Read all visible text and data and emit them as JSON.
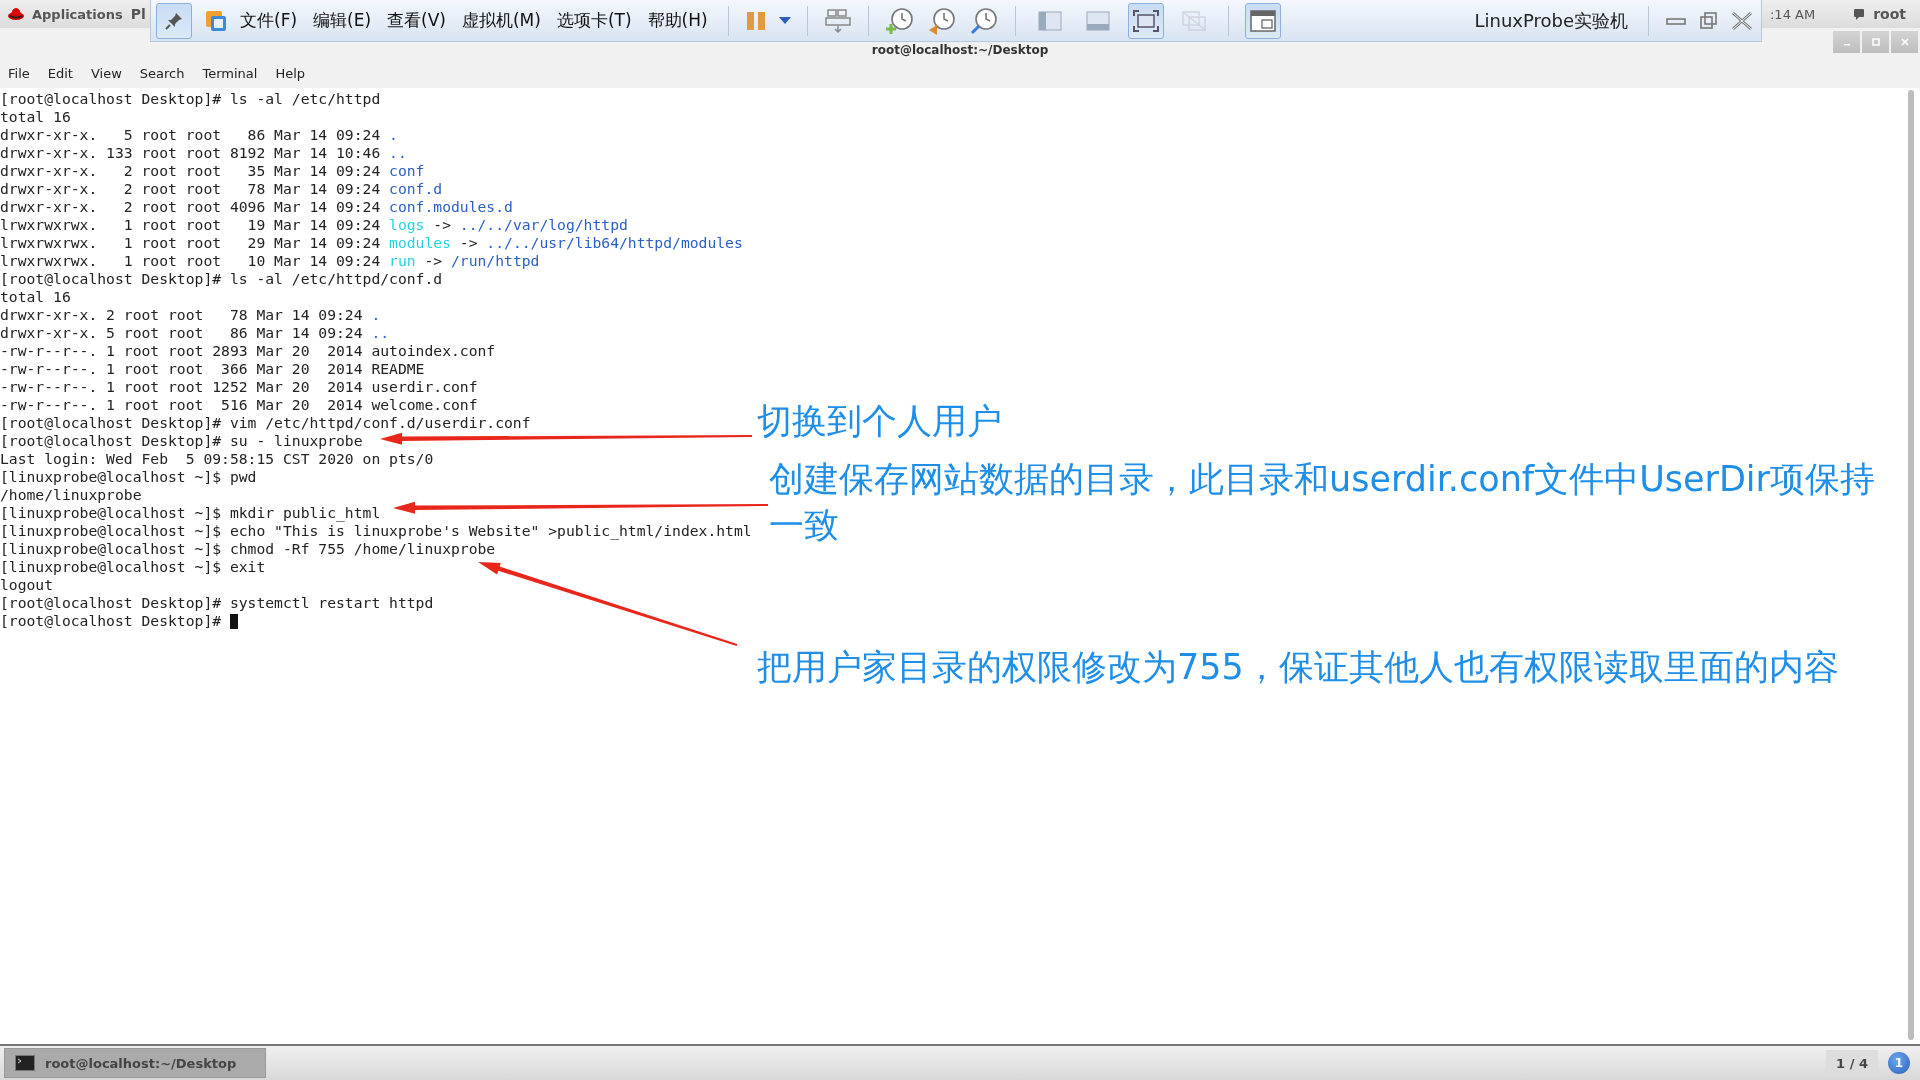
{
  "top_bar": {
    "applications": "Applications",
    "places": "Pl",
    "clock": ":14 AM",
    "user": "root"
  },
  "vm_toolbar": {
    "pinned": true,
    "menus": [
      "文件(F)",
      "编辑(E)",
      "查看(V)",
      "虚拟机(M)",
      "选项卡(T)",
      "帮助(H)"
    ],
    "view_modes": [
      {
        "selected": false,
        "disabled": false
      },
      {
        "selected": false,
        "disabled": false
      },
      {
        "selected": true,
        "disabled": false
      },
      {
        "selected": false,
        "disabled": true
      }
    ],
    "console_view": {
      "selected": true
    },
    "title": "LinuxProbe实验机"
  },
  "terminal": {
    "title": "root@localhost:~/Desktop",
    "menus": [
      "File",
      "Edit",
      "View",
      "Search",
      "Terminal",
      "Help"
    ],
    "lines": [
      {
        "segments": [
          {
            "kind": "plain",
            "text": "[root@localhost Desktop]# ls -al /etc/httpd"
          }
        ]
      },
      {
        "segments": [
          {
            "kind": "plain",
            "text": "total 16"
          }
        ]
      },
      {
        "segments": [
          {
            "kind": "plain",
            "text": "drwxr-xr-x.   5 root root   86 Mar 14 09:24 "
          },
          {
            "kind": "dir",
            "text": "."
          }
        ]
      },
      {
        "segments": [
          {
            "kind": "plain",
            "text": "drwxr-xr-x. 133 root root 8192 Mar 14 10:46 "
          },
          {
            "kind": "dir",
            "text": ".."
          }
        ]
      },
      {
        "segments": [
          {
            "kind": "plain",
            "text": "drwxr-xr-x.   2 root root   35 Mar 14 09:24 "
          },
          {
            "kind": "dir",
            "text": "conf"
          }
        ]
      },
      {
        "segments": [
          {
            "kind": "plain",
            "text": "drwxr-xr-x.   2 root root   78 Mar 14 09:24 "
          },
          {
            "kind": "dir",
            "text": "conf.d"
          }
        ]
      },
      {
        "segments": [
          {
            "kind": "plain",
            "text": "drwxr-xr-x.   2 root root 4096 Mar 14 09:24 "
          },
          {
            "kind": "dir",
            "text": "conf.modules.d"
          }
        ]
      },
      {
        "segments": [
          {
            "kind": "plain",
            "text": "lrwxrwxrwx.   1 root root   19 Mar 14 09:24 "
          },
          {
            "kind": "link",
            "text": "logs"
          },
          {
            "kind": "plain",
            "text": " -> "
          },
          {
            "kind": "dir",
            "text": "../../var/log/httpd"
          }
        ]
      },
      {
        "segments": [
          {
            "kind": "plain",
            "text": "lrwxrwxrwx.   1 root root   29 Mar 14 09:24 "
          },
          {
            "kind": "link",
            "text": "modules"
          },
          {
            "kind": "plain",
            "text": " -> "
          },
          {
            "kind": "dir",
            "text": "../../usr/lib64/httpd/modules"
          }
        ]
      },
      {
        "segments": [
          {
            "kind": "plain",
            "text": "lrwxrwxrwx.   1 root root   10 Mar 14 09:24 "
          },
          {
            "kind": "link",
            "text": "run"
          },
          {
            "kind": "plain",
            "text": " -> "
          },
          {
            "kind": "dir",
            "text": "/run/httpd"
          }
        ]
      },
      {
        "segments": [
          {
            "kind": "plain",
            "text": "[root@localhost Desktop]# ls -al /etc/httpd/conf.d"
          }
        ]
      },
      {
        "segments": [
          {
            "kind": "plain",
            "text": "total 16"
          }
        ]
      },
      {
        "segments": [
          {
            "kind": "plain",
            "text": "drwxr-xr-x. 2 root root   78 Mar 14 09:24 "
          },
          {
            "kind": "dir",
            "text": "."
          }
        ]
      },
      {
        "segments": [
          {
            "kind": "plain",
            "text": "drwxr-xr-x. 5 root root   86 Mar 14 09:24 "
          },
          {
            "kind": "dir",
            "text": ".."
          }
        ]
      },
      {
        "segments": [
          {
            "kind": "plain",
            "text": "-rw-r--r--. 1 root root 2893 Mar 20  2014 autoindex.conf"
          }
        ]
      },
      {
        "segments": [
          {
            "kind": "plain",
            "text": "-rw-r--r--. 1 root root  366 Mar 20  2014 README"
          }
        ]
      },
      {
        "segments": [
          {
            "kind": "plain",
            "text": "-rw-r--r--. 1 root root 1252 Mar 20  2014 userdir.conf"
          }
        ]
      },
      {
        "segments": [
          {
            "kind": "plain",
            "text": "-rw-r--r--. 1 root root  516 Mar 20  2014 welcome.conf"
          }
        ]
      },
      {
        "segments": [
          {
            "kind": "plain",
            "text": "[root@localhost Desktop]# vim /etc/httpd/conf.d/userdir.conf"
          }
        ]
      },
      {
        "segments": [
          {
            "kind": "plain",
            "text": "[root@localhost Desktop]# su - linuxprobe"
          }
        ]
      },
      {
        "segments": [
          {
            "kind": "plain",
            "text": "Last login: Wed Feb  5 09:58:15 CST 2020 on pts/0"
          }
        ]
      },
      {
        "segments": [
          {
            "kind": "plain",
            "text": "[linuxprobe@localhost ~]$ pwd"
          }
        ]
      },
      {
        "segments": [
          {
            "kind": "plain",
            "text": "/home/linuxprobe"
          }
        ]
      },
      {
        "segments": [
          {
            "kind": "plain",
            "text": "[linuxprobe@localhost ~]$ mkdir public_html"
          }
        ]
      },
      {
        "segments": [
          {
            "kind": "plain",
            "text": "[linuxprobe@localhost ~]$ echo \"This is linuxprobe's Website\" >public_html/index.html"
          }
        ]
      },
      {
        "segments": [
          {
            "kind": "plain",
            "text": "[linuxprobe@localhost ~]$ chmod -Rf 755 /home/linuxprobe"
          }
        ]
      },
      {
        "segments": [
          {
            "kind": "plain",
            "text": "[linuxprobe@localhost ~]$ exit"
          }
        ]
      },
      {
        "segments": [
          {
            "kind": "plain",
            "text": "logout"
          }
        ]
      },
      {
        "segments": [
          {
            "kind": "plain",
            "text": "[root@localhost Desktop]# systemctl restart httpd"
          }
        ]
      },
      {
        "segments": [
          {
            "kind": "plain",
            "text": "[root@localhost Desktop]# "
          }
        ],
        "cursor": true
      }
    ]
  },
  "annotations": [
    {
      "text": "切换到个人用户"
    },
    {
      "text": "创建保存网站数据的目录，此目录和userdir.conf文件中UserDir项保持一致"
    },
    {
      "text": "把用户家目录的权限修改为755，保证其他人也有权限读取里面的内容"
    }
  ],
  "taskbar": {
    "task": "root@localhost:~/Desktop",
    "workspace": "1 / 4",
    "notifications": "1"
  }
}
